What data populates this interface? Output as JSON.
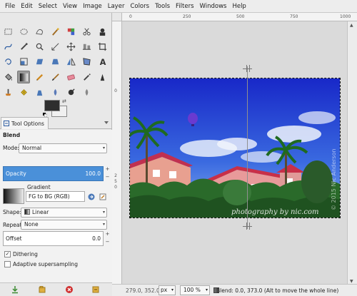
{
  "menubar": {
    "items": [
      "File",
      "Edit",
      "Select",
      "View",
      "Image",
      "Layer",
      "Colors",
      "Tools",
      "Filters",
      "Windows",
      "Help"
    ]
  },
  "toolbox": {
    "tools": [
      "rect-select-icon",
      "ellipse-select-icon",
      "free-select-icon",
      "fuzzy-select-icon",
      "select-by-color-icon",
      "scissors-select-icon",
      "foreground-select-icon",
      "paths-icon",
      "color-picker-icon",
      "zoom-icon",
      "measure-icon",
      "move-icon",
      "align-icon",
      "crop-icon",
      "rotate-icon",
      "scale-icon",
      "shear-icon",
      "perspective-icon",
      "flip-icon",
      "cage-transform-icon",
      "text-icon",
      "bucket-fill-icon",
      "blend-icon",
      "pencil-icon",
      "paintbrush-icon",
      "eraser-icon",
      "airbrush-icon",
      "ink-icon",
      "clone-icon",
      "heal-icon",
      "perspective-clone-icon",
      "smudge-icon",
      "dodge-burn-icon",
      "blur-icon"
    ],
    "active_tool": "blend-icon",
    "fg_color": "#2e2e2e",
    "bg_color": "#f0f0f0"
  },
  "tool_options": {
    "tab_label": "Tool Options",
    "title": "Blend",
    "mode_label": "Mode:",
    "mode_value": "Normal",
    "opacity_label": "Opacity",
    "opacity_value": "100.0",
    "gradient_label": "Gradient",
    "gradient_value": "FG to BG (RGB)",
    "shape_label": "Shape:",
    "shape_value": "Linear",
    "repeat_label": "Repeat:",
    "repeat_value": "None",
    "offset_label": "Offset",
    "offset_value": "0.0",
    "dithering_label": "Dithering",
    "dithering_checked": true,
    "adaptive_label": "Adaptive supersampling",
    "adaptive_checked": false
  },
  "rulers": {
    "horizontal": [
      "0",
      "250",
      "500",
      "750",
      "1000"
    ],
    "vertical": [
      "0",
      "2",
      "5",
      "0"
    ]
  },
  "image": {
    "watermark": "photography by nic.com",
    "side_watermark": "© 2015 Nic Anderson"
  },
  "statusbar": {
    "coords": "279.0, 352.0",
    "unit": "px",
    "zoom": "100 %",
    "message": "Blend: 0.0, 373.0 (Alt to move the whole line)"
  }
}
